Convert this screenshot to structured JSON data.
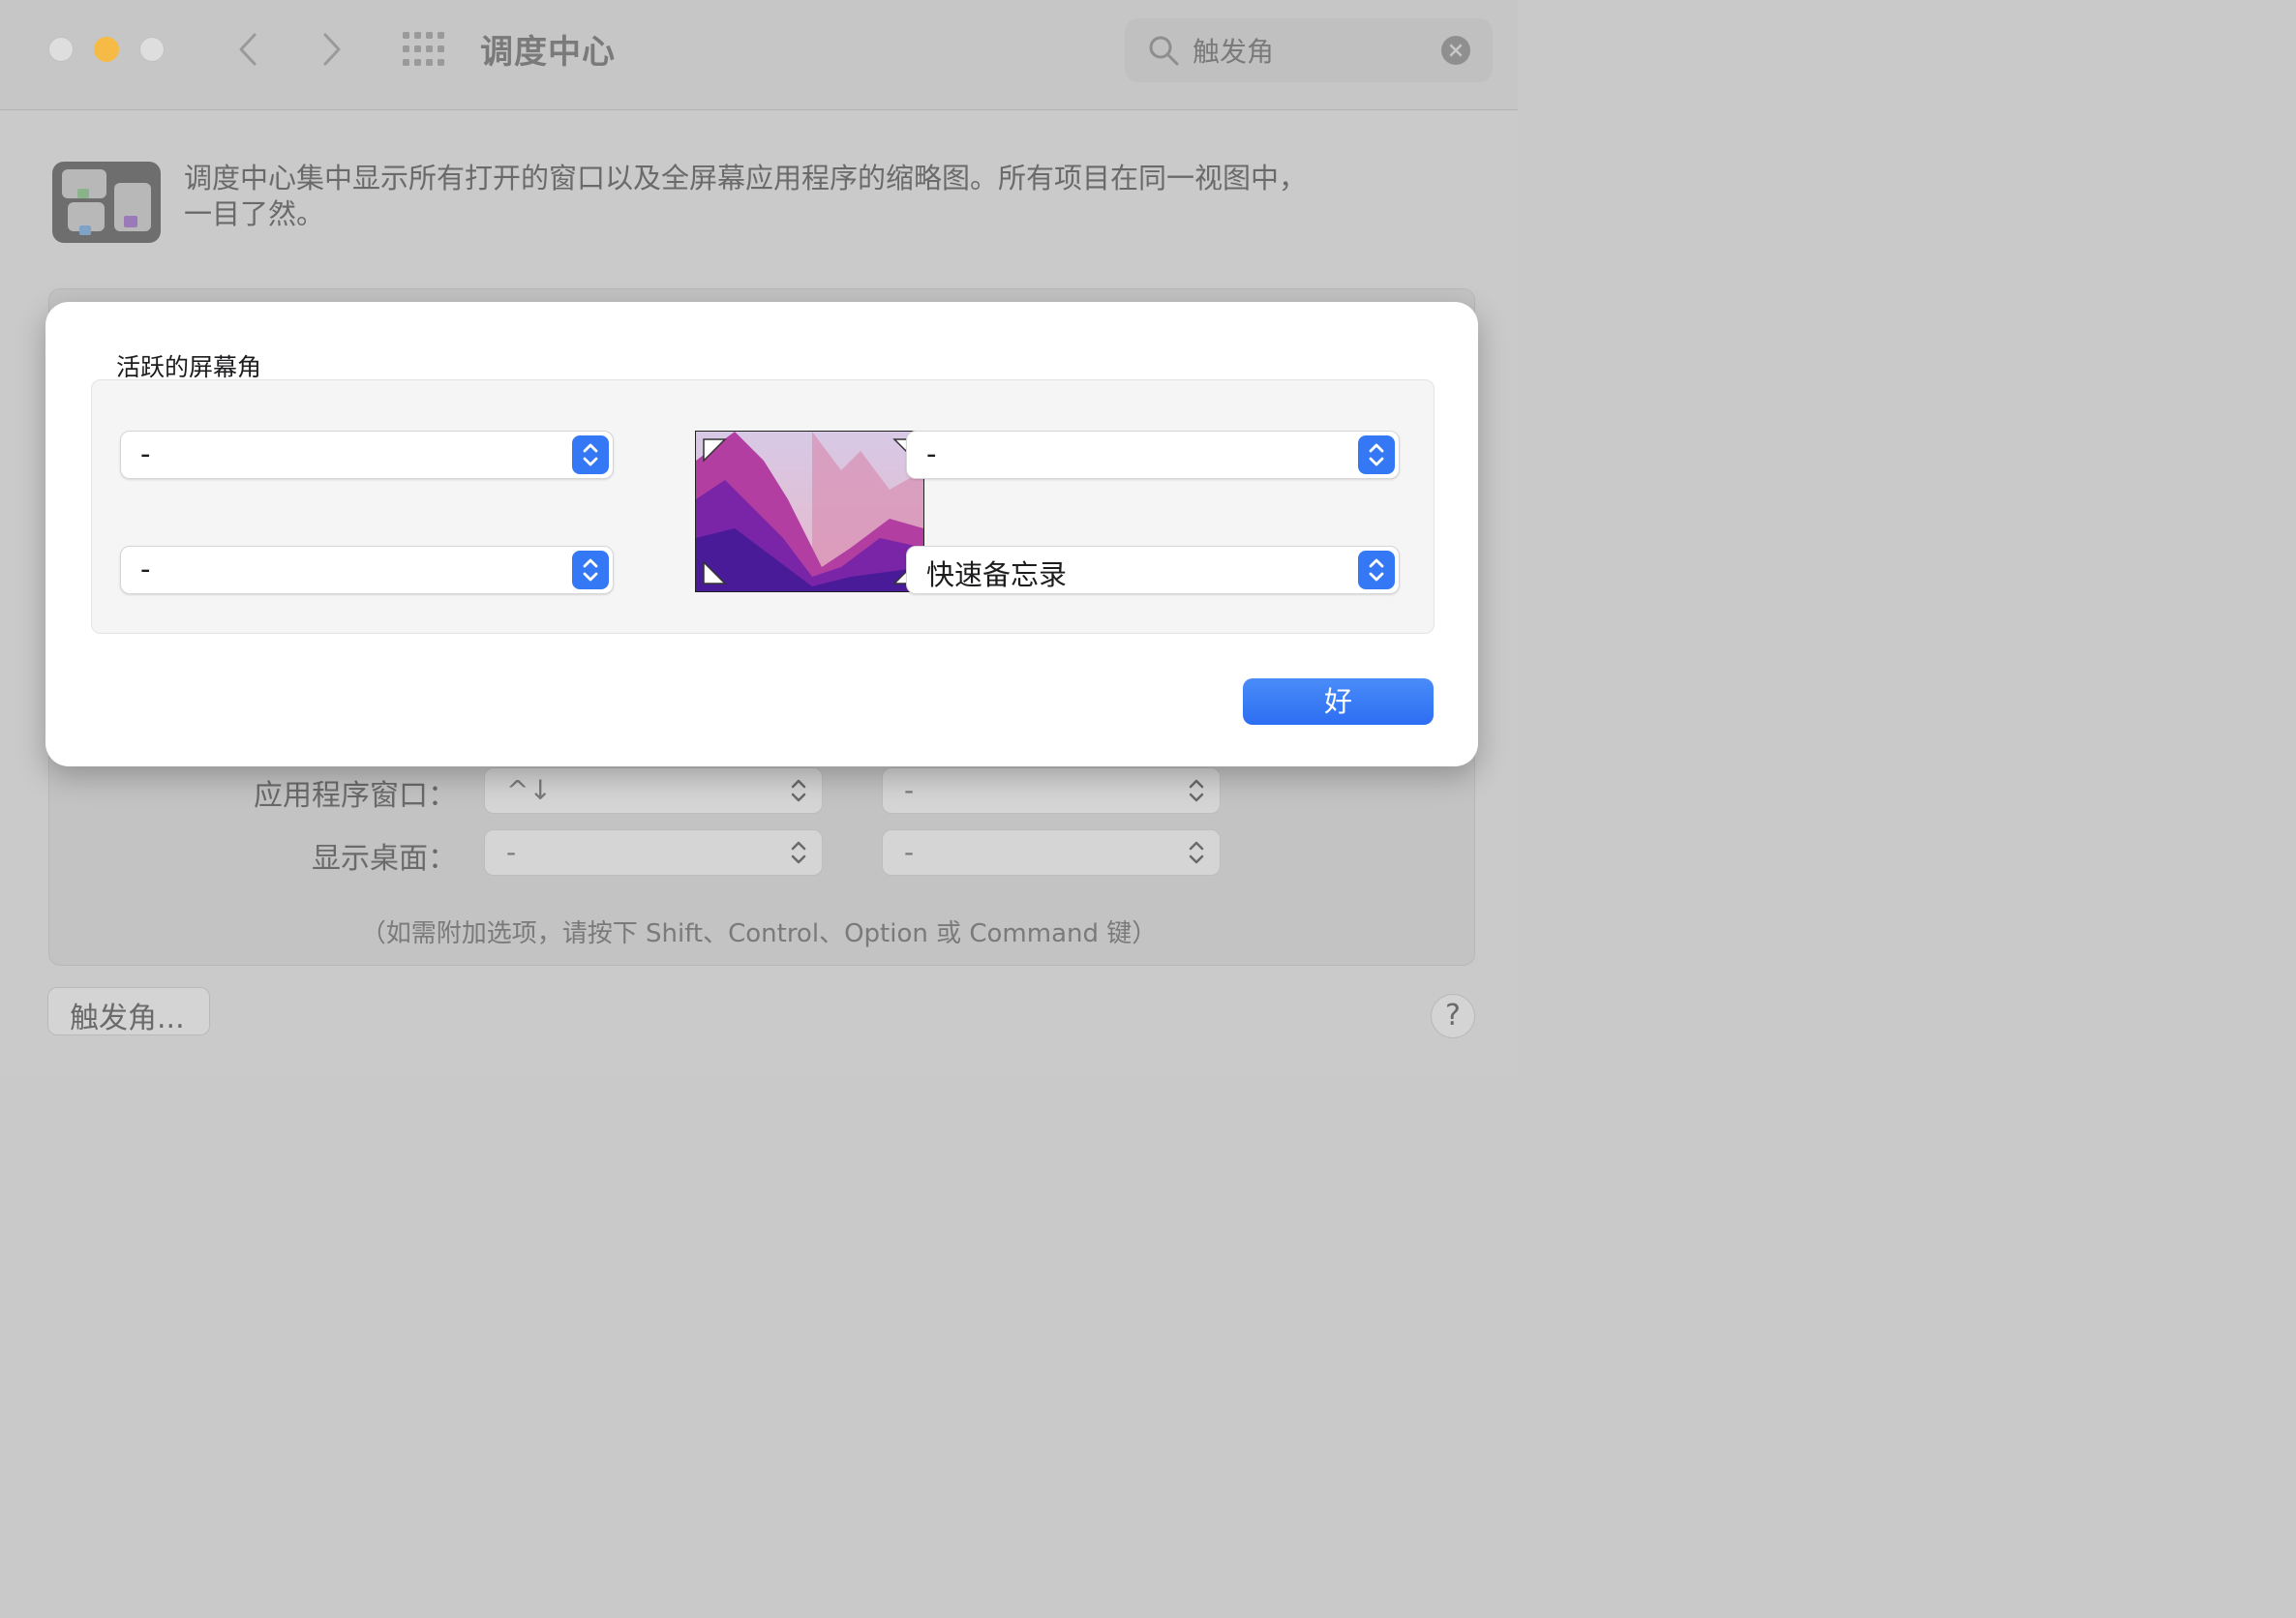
{
  "window": {
    "title": "调度中心",
    "search": {
      "value": "触发角"
    }
  },
  "header": {
    "description_line1": "调度中心集中显示所有打开的窗口以及全屏幕应用程序的缩略图。所有项目在同一视图中，",
    "description_line2": "一目了然。"
  },
  "shortcuts": {
    "rows": [
      {
        "label": "应用程序窗口：",
        "keyboard": "^↓",
        "mouse": "-"
      },
      {
        "label": "显示桌面：",
        "keyboard": "-",
        "mouse": "-"
      }
    ],
    "hint": "（如需附加选项，请按下 Shift、Control、Option 或 Command 键）"
  },
  "hot_corners_button": "触发角...",
  "help_label": "?",
  "sheet": {
    "title": "活跃的屏幕角",
    "top_left": "-",
    "top_right": "-",
    "bottom_left": "-",
    "bottom_right": "快速备忘录",
    "ok_label": "好"
  },
  "colors": {
    "accent": "#3478f6",
    "minimize": "#f6bb46"
  }
}
